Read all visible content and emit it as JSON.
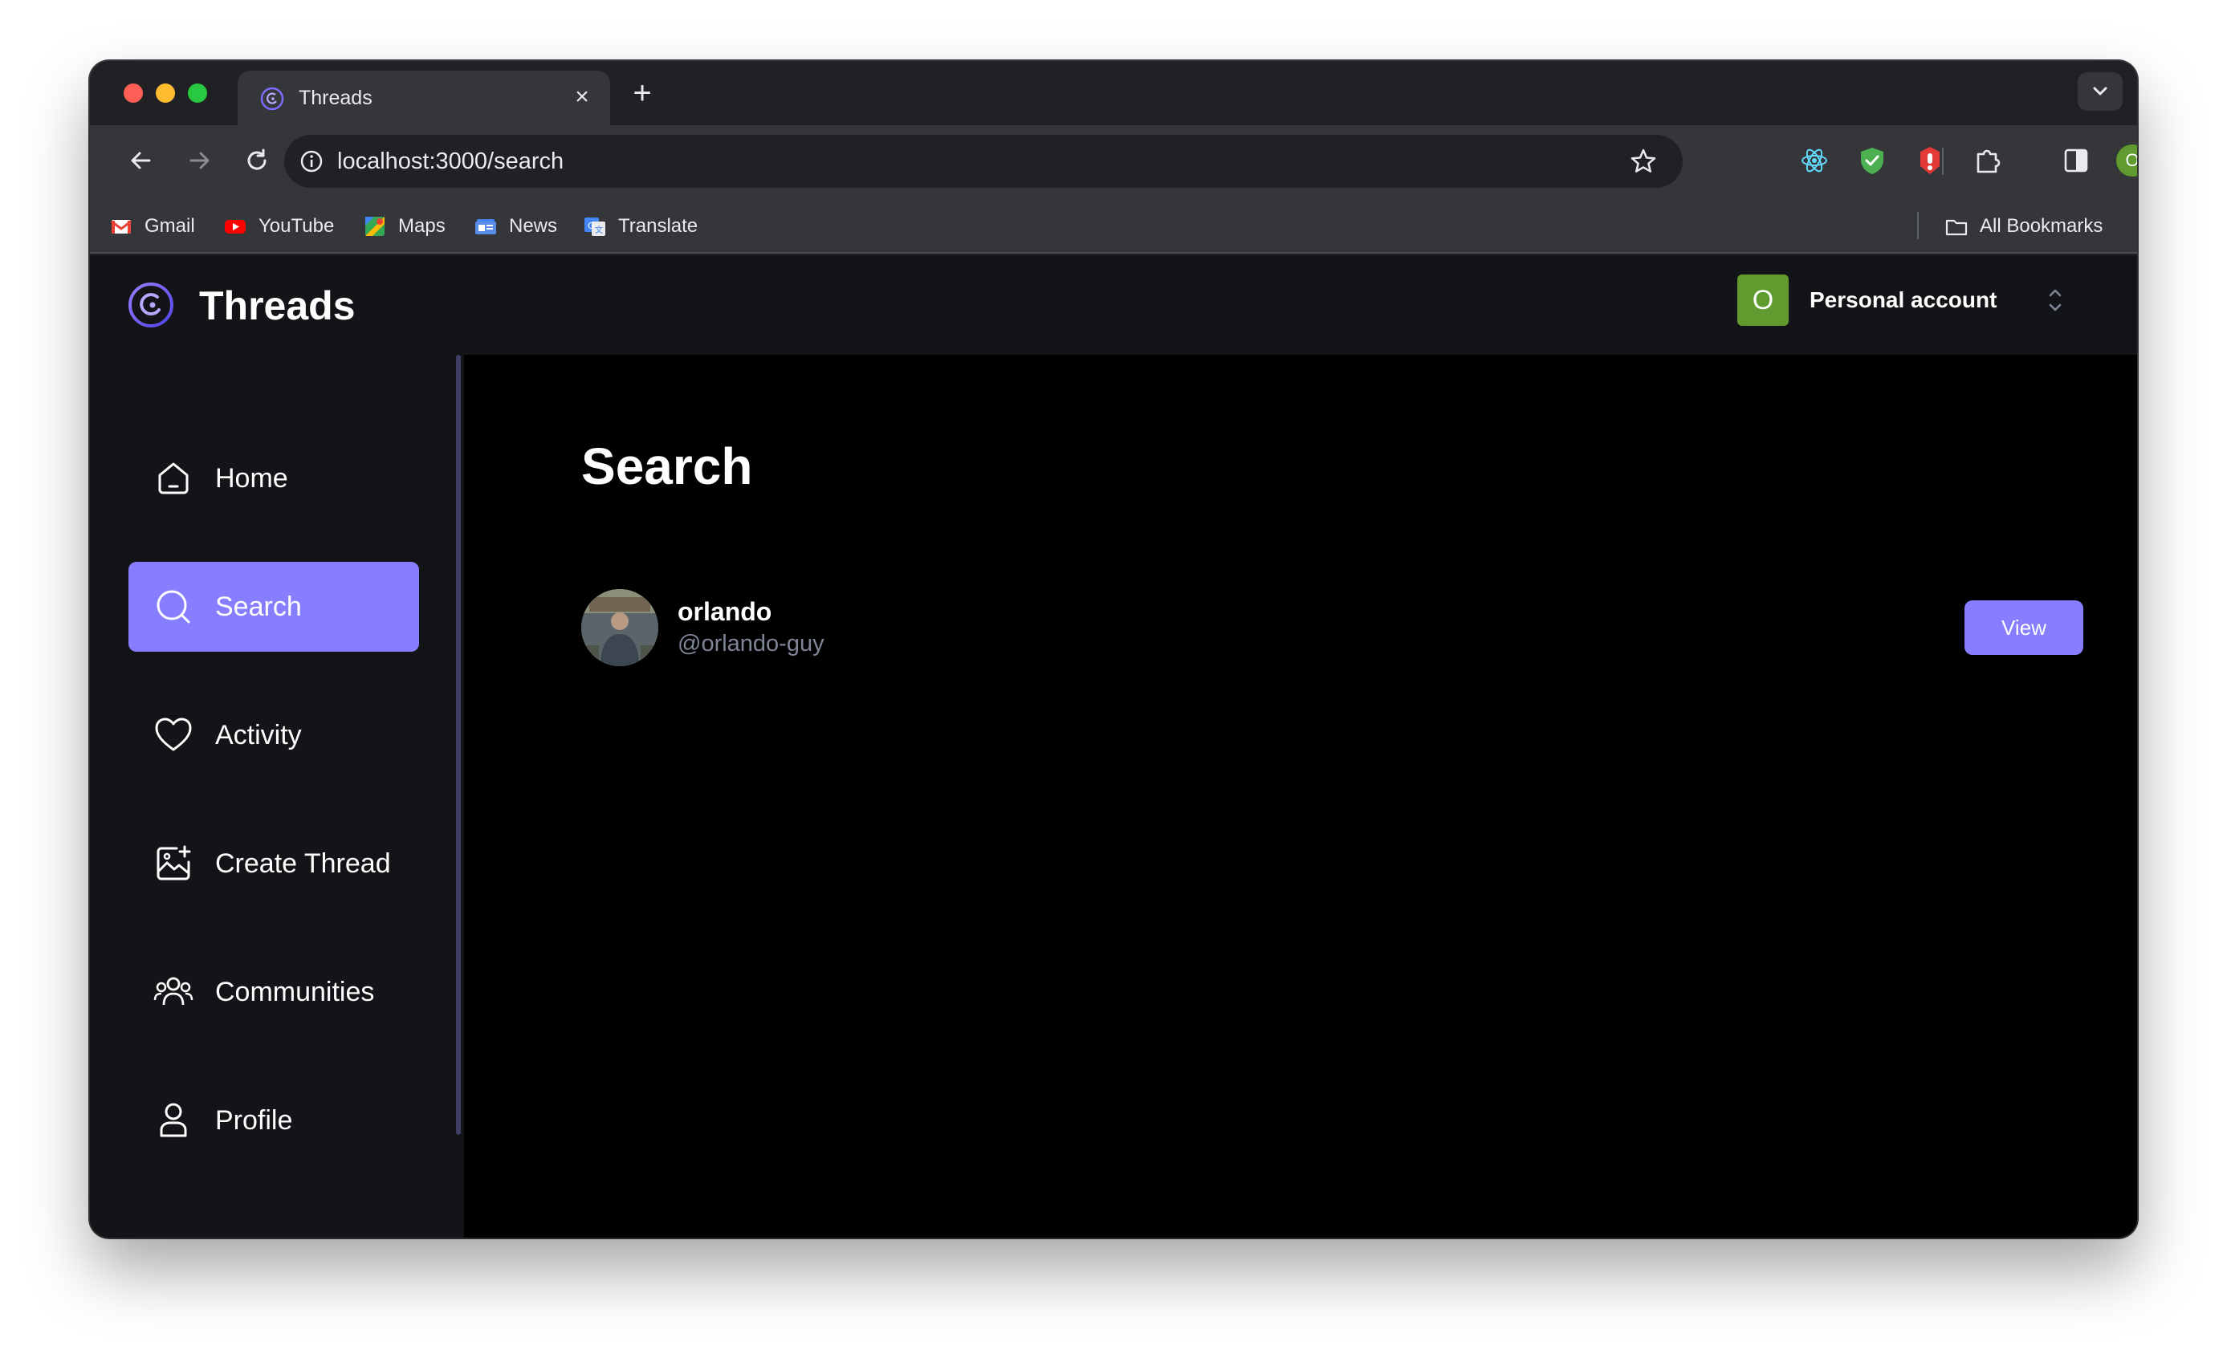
{
  "browser": {
    "tab_title": "Threads",
    "new_tab_label": "+",
    "url": "localhost:3000/search",
    "profile_initial": "O",
    "bookmarks": [
      {
        "label": "Gmail",
        "icon": "gmail-icon"
      },
      {
        "label": "YouTube",
        "icon": "youtube-icon"
      },
      {
        "label": "Maps",
        "icon": "maps-icon"
      },
      {
        "label": "News",
        "icon": "news-icon"
      },
      {
        "label": "Translate",
        "icon": "translate-icon"
      }
    ],
    "all_bookmarks_label": "All Bookmarks"
  },
  "app": {
    "name": "Threads",
    "accent_color": "#877eff",
    "org_switcher": {
      "initial": "O",
      "label": "Personal account"
    }
  },
  "sidebar": {
    "items": [
      {
        "label": "Home",
        "icon": "home-icon",
        "active": false
      },
      {
        "label": "Search",
        "icon": "search-icon",
        "active": true
      },
      {
        "label": "Activity",
        "icon": "heart-icon",
        "active": false
      },
      {
        "label": "Create Thread",
        "icon": "create-thread-icon",
        "active": false
      },
      {
        "label": "Communities",
        "icon": "communities-icon",
        "active": false
      },
      {
        "label": "Profile",
        "icon": "user-icon",
        "active": false
      }
    ]
  },
  "main": {
    "title": "Search",
    "results": [
      {
        "name": "orlando",
        "handle": "@orlando-guy",
        "action_label": "View"
      }
    ]
  }
}
